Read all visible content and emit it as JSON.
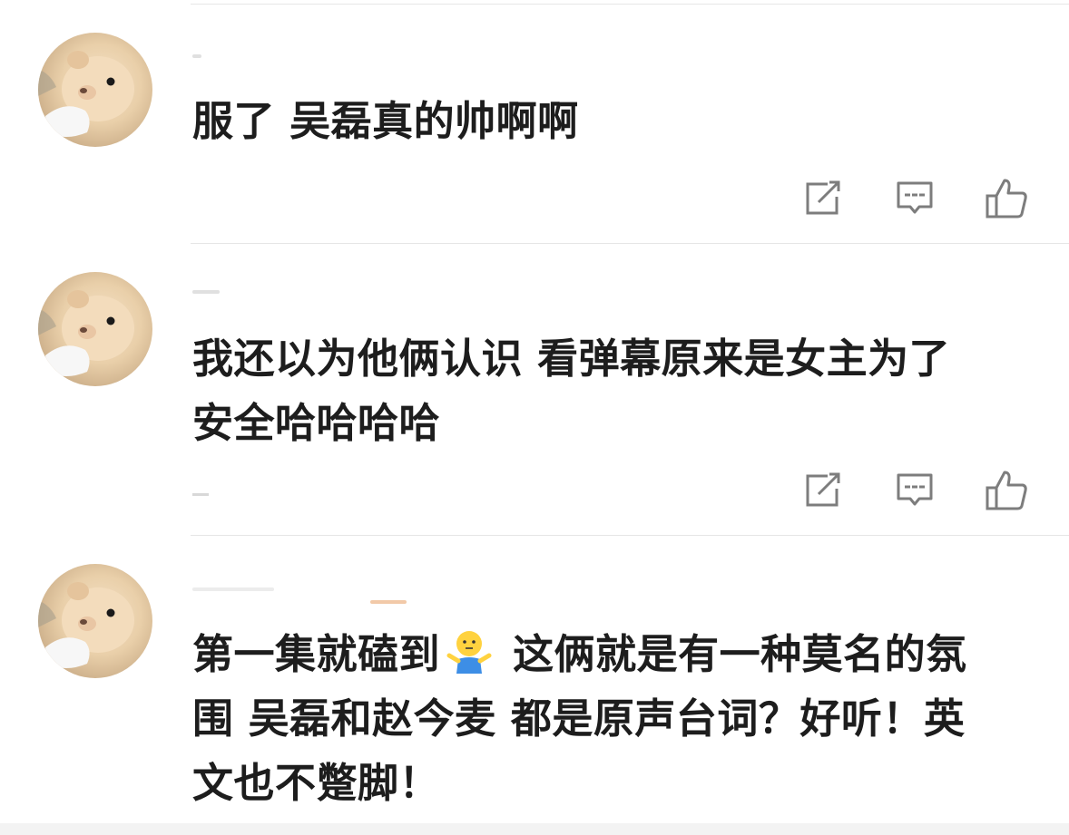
{
  "comments": [
    {
      "text": "服了 吴磊真的帅啊啊",
      "avatar": "hamster-avatar",
      "actions": [
        "share-icon",
        "reply-icon",
        "like-icon"
      ]
    },
    {
      "text_line1": "我还以为他俩认识 看弹幕原来是女主为了",
      "text_line2": "安全哈哈哈哈",
      "avatar": "hamster-avatar",
      "actions": [
        "share-icon",
        "reply-icon",
        "like-icon"
      ]
    },
    {
      "text_part1": "第一集就磕到",
      "emoji": "shrug-person-emoji",
      "text_part2": " 这俩就是有一种莫名的氛",
      "text_line2": "围 吴磊和赵今麦 都是原声台词？好听！英",
      "text_line3": "文也不蹩脚！",
      "avatar": "hamster-avatar"
    }
  ],
  "colors": {
    "icon": "#7d7d7d",
    "divider": "#e6e6e6",
    "text": "#1d1d1d"
  }
}
